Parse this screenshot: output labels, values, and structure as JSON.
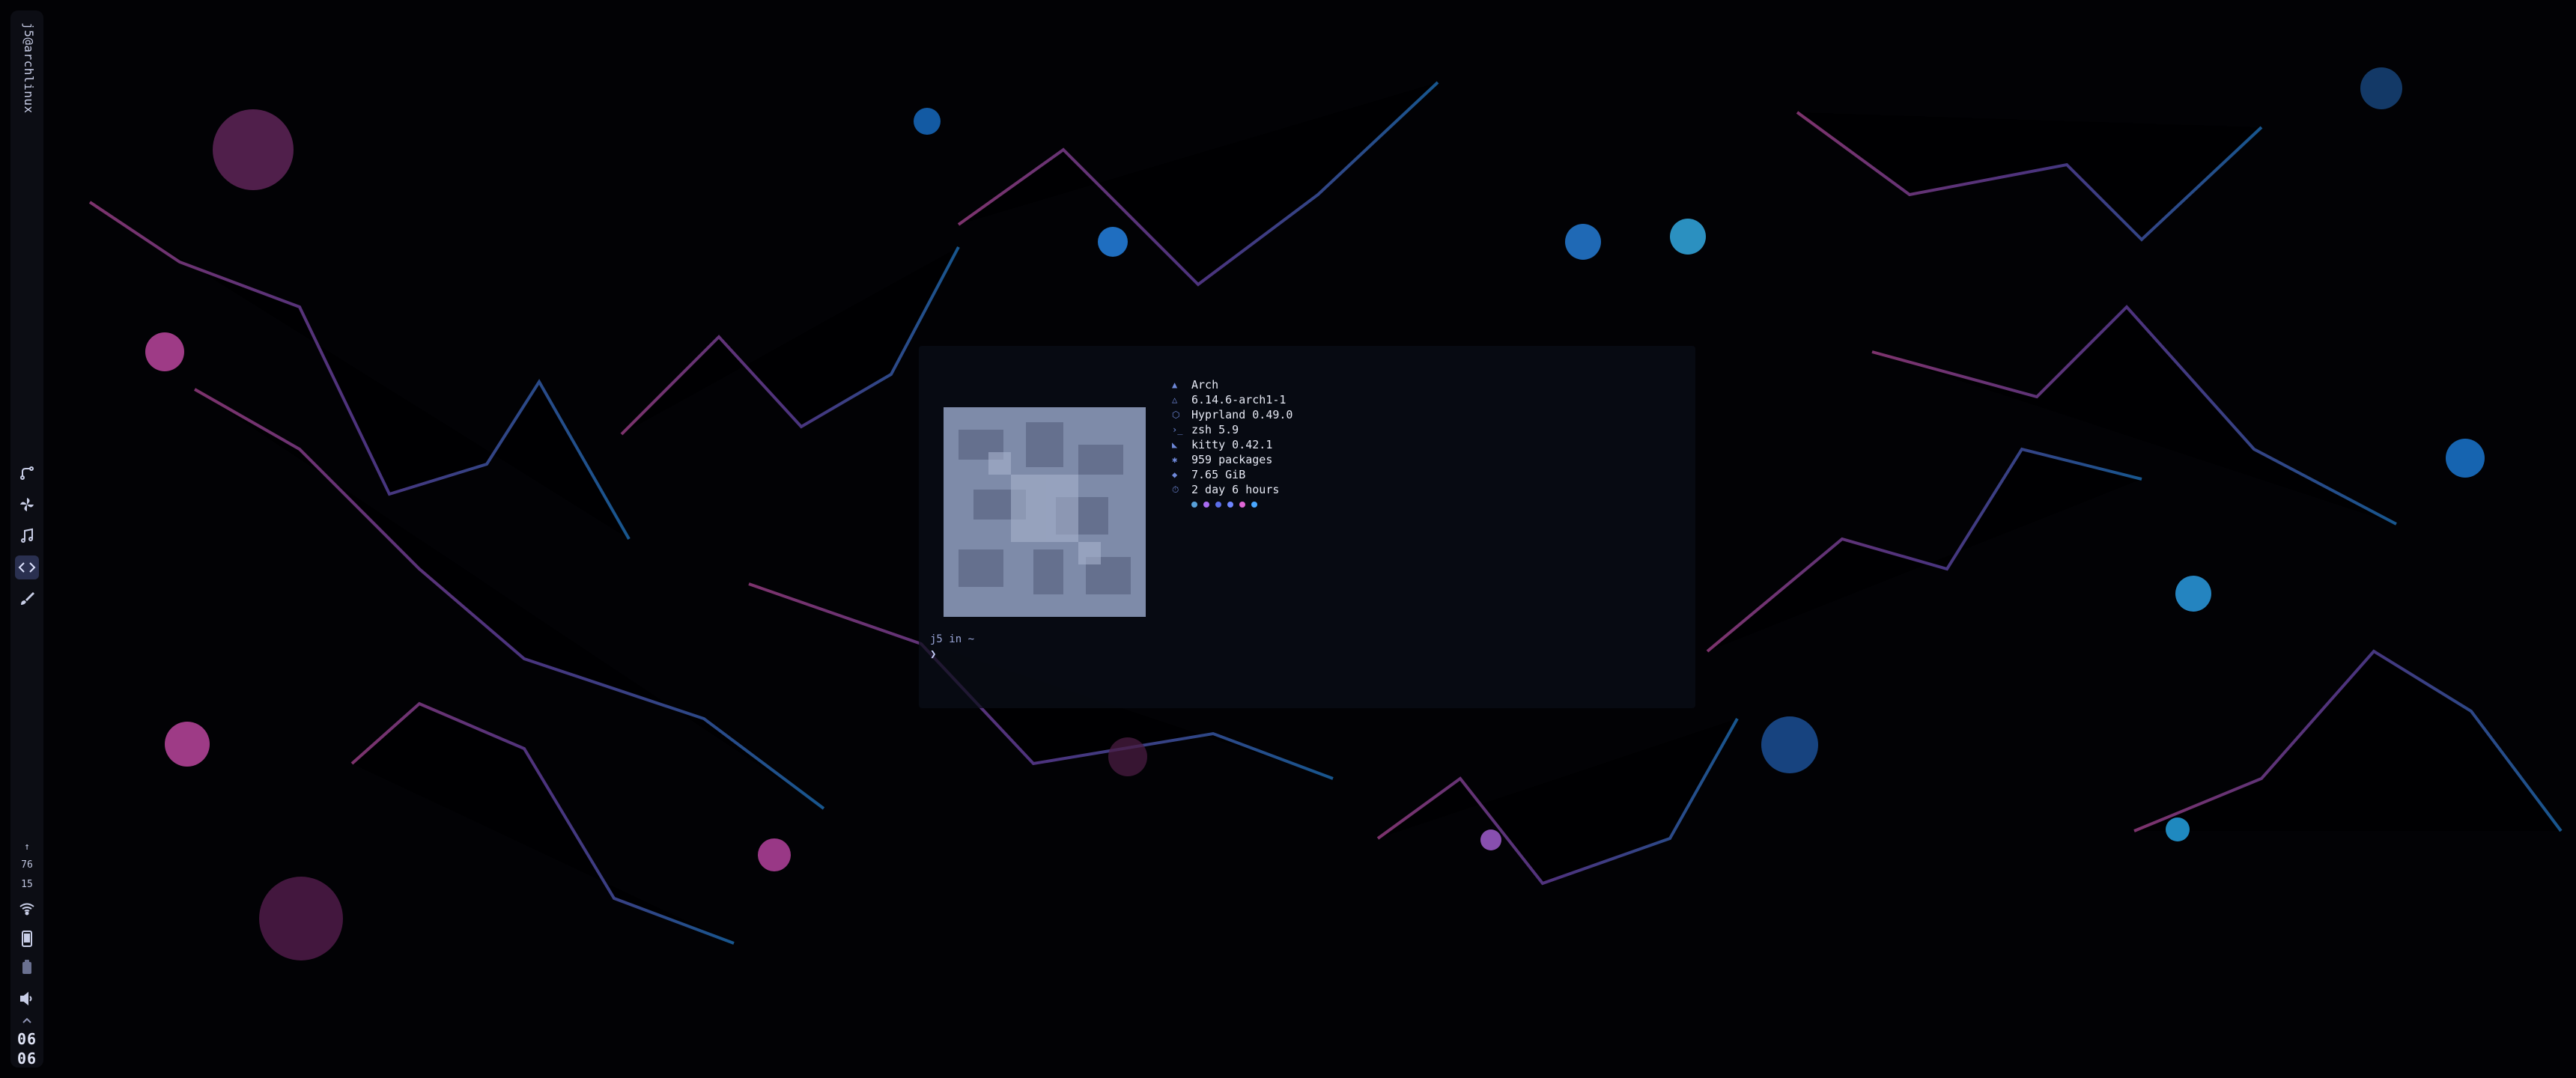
{
  "bar": {
    "user": "j5@archlinux",
    "workspaces": [
      {
        "name": "git-icon",
        "active": false
      },
      {
        "name": "pinwheel-icon",
        "active": false
      },
      {
        "name": "music-icon",
        "active": false
      },
      {
        "name": "code-icon",
        "active": true
      },
      {
        "name": "brush-icon",
        "active": false
      }
    ],
    "resources": {
      "arrow": "↑",
      "value_a": "76",
      "value_b": "15"
    },
    "clock": {
      "hour": "06",
      "minute": "06"
    }
  },
  "terminal": {
    "info": [
      {
        "icon": "arch-icon",
        "glyph": "▲",
        "value": "Arch"
      },
      {
        "icon": "kernel-icon",
        "glyph": "△",
        "value": "6.14.6-arch1-1"
      },
      {
        "icon": "wm-icon",
        "glyph": "⬡",
        "value": "Hyprland 0.49.0"
      },
      {
        "icon": "shell-icon",
        "glyph": "›_",
        "value": "zsh 5.9"
      },
      {
        "icon": "terminal-icon",
        "glyph": "◣",
        "value": "kitty 0.42.1"
      },
      {
        "icon": "package-icon",
        "glyph": "✱",
        "value": "959 packages"
      },
      {
        "icon": "memory-icon",
        "glyph": "◆",
        "value": "7.65 GiB"
      },
      {
        "icon": "uptime-icon",
        "glyph": "⏱",
        "value": "2 day 6 hours"
      }
    ],
    "swatches": [
      "#58a0d8",
      "#a86cf0",
      "#5b6ee8",
      "#6f86ff",
      "#e066d6",
      "#4aa8ff"
    ],
    "prompt_line": "j5 in ~",
    "cursor_line": "❯"
  }
}
